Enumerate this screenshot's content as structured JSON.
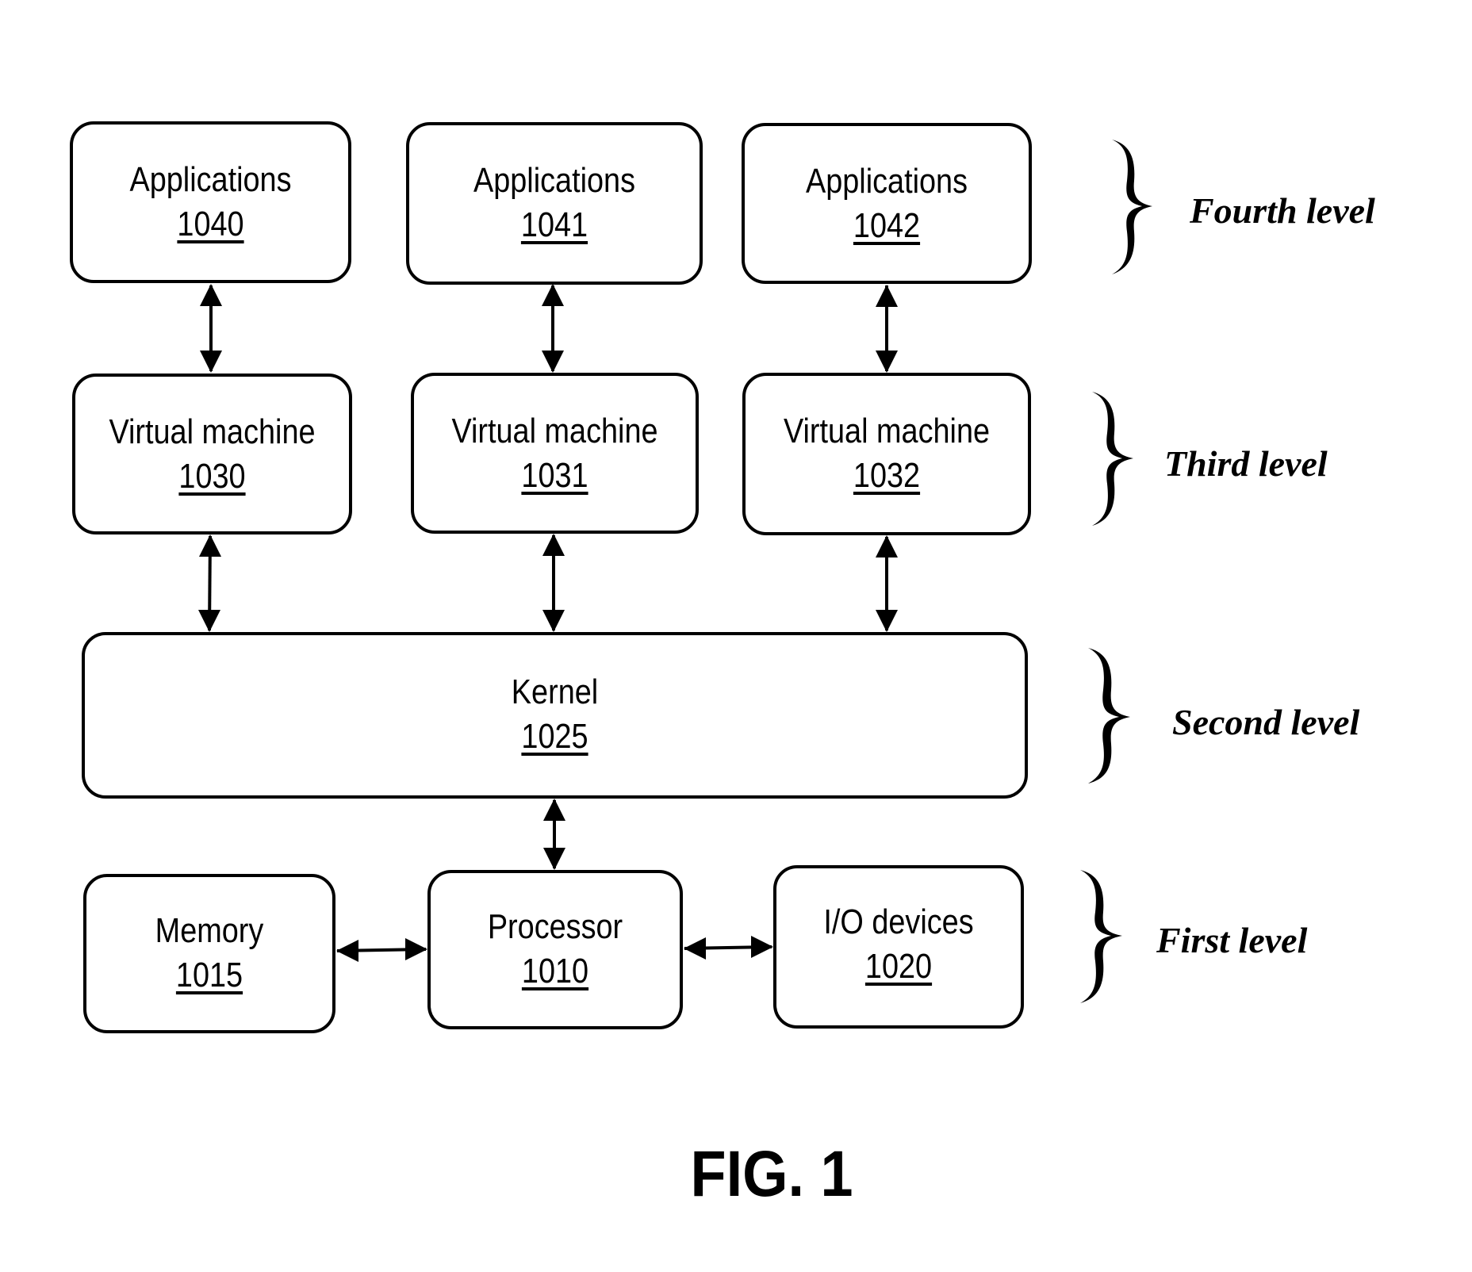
{
  "figure": {
    "caption": "FIG. 1"
  },
  "boxes": {
    "app_1040": {
      "name": "Applications",
      "ref": "1040"
    },
    "app_1041": {
      "name": "Applications",
      "ref": "1041"
    },
    "app_1042": {
      "name": "Applications",
      "ref": "1042"
    },
    "vm_1030": {
      "name": "Virtual machine",
      "ref": "1030"
    },
    "vm_1031": {
      "name": "Virtual machine",
      "ref": "1031"
    },
    "vm_1032": {
      "name": "Virtual machine",
      "ref": "1032"
    },
    "kernel_1025": {
      "name": "Kernel",
      "ref": "1025"
    },
    "memory_1015": {
      "name": "Memory",
      "ref": "1015"
    },
    "processor_1010": {
      "name": "Processor",
      "ref": "1010"
    },
    "io_1020": {
      "name": "I/O devices",
      "ref": "1020"
    }
  },
  "levels": {
    "fourth": "Fourth level",
    "third": "Third level",
    "second": "Second level",
    "first": "First level"
  },
  "connections": [
    {
      "from": "1040",
      "to": "1030",
      "type": "bidirectional"
    },
    {
      "from": "1041",
      "to": "1031",
      "type": "bidirectional"
    },
    {
      "from": "1042",
      "to": "1032",
      "type": "bidirectional"
    },
    {
      "from": "1030",
      "to": "1025",
      "type": "bidirectional"
    },
    {
      "from": "1031",
      "to": "1025",
      "type": "bidirectional"
    },
    {
      "from": "1032",
      "to": "1025",
      "type": "bidirectional"
    },
    {
      "from": "1025",
      "to": "1010",
      "type": "bidirectional"
    },
    {
      "from": "1015",
      "to": "1010",
      "type": "bidirectional"
    },
    {
      "from": "1010",
      "to": "1020",
      "type": "bidirectional"
    }
  ]
}
